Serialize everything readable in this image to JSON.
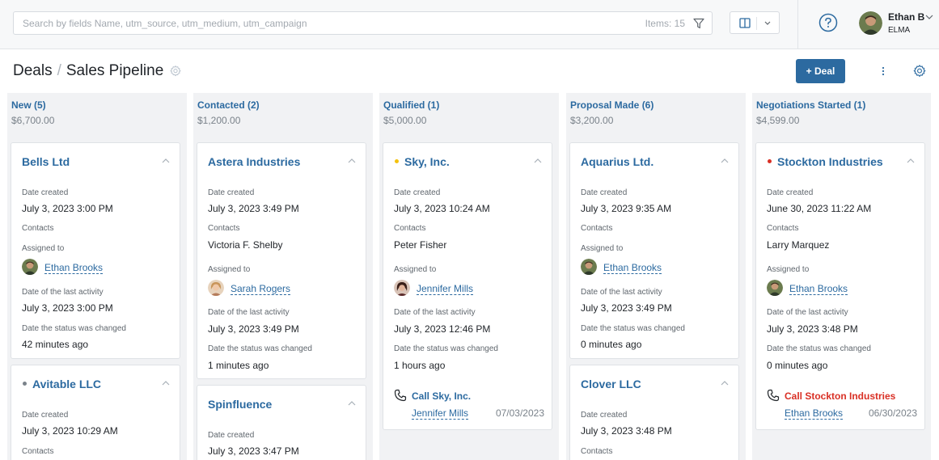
{
  "search": {
    "placeholder": "Search by fields Name, utm_source, utm_medium, utm_campaign",
    "items_count": "Items: 15"
  },
  "user": {
    "name": "Ethan B",
    "company": "ELMA"
  },
  "header": {
    "section": "Deals",
    "separator": "/",
    "page": "Sales Pipeline",
    "add_deal_label": "+ Deal"
  },
  "icons": {
    "filter": "filter-icon",
    "view": "columns-view-icon",
    "help": "help-circle-icon",
    "gear": "gear-icon",
    "more": "more-vertical-icon",
    "chevron": "chevron-up-icon",
    "phone": "phone-icon"
  },
  "colors": {
    "accent": "#2c6aa0",
    "overdue": "#d93025",
    "dot_yellow": "#f4c20d",
    "dot_red": "#d93025",
    "dot_gray": "#7a828a"
  },
  "labels": {
    "date_created": "Date created",
    "contacts": "Contacts",
    "assigned_to": "Assigned to",
    "last_activity": "Date of the last activity",
    "status_changed": "Date the status was changed"
  },
  "columns": [
    {
      "title": "New (5)",
      "sum": "$6,700.00",
      "cards": [
        {
          "name": "Bells Ltd",
          "created": "July 3, 2023 3:00 PM",
          "contact": "",
          "assignee": "Ethan Brooks",
          "last_activity": "July 3, 2023 3:00 PM",
          "status_changed": "42 minutes ago"
        },
        {
          "name": "Avitable LLC",
          "created": "July 3, 2023 10:29 AM"
        }
      ]
    },
    {
      "title": "Contacted (2)",
      "sum": "$1,200.00",
      "cards": [
        {
          "name": "Astera Industries",
          "created": "July 3, 2023 3:49 PM",
          "contact": "Victoria F. Shelby",
          "assignee": "Sarah Rogers",
          "last_activity": "July 3, 2023 3:49 PM",
          "status_changed": "1 minutes ago"
        },
        {
          "name": "Spinfluence",
          "created": "July 3, 2023 3:47 PM"
        }
      ]
    },
    {
      "title": "Qualified (1)",
      "sum": "$5,000.00",
      "cards": [
        {
          "name": "Sky, Inc.",
          "created": "July 3, 2023 10:24 AM",
          "contact": "Peter Fisher",
          "assignee": "Jennifer Mills",
          "last_activity": "July 3, 2023 12:46 PM",
          "status_changed": "1 hours ago",
          "task": {
            "title": "Call Sky, Inc.",
            "assignee": "Jennifer Mills",
            "date": "07/03/2023"
          }
        }
      ]
    },
    {
      "title": "Proposal Made (6)",
      "sum": "$3,200.00",
      "cards": [
        {
          "name": "Aquarius Ltd.",
          "created": "July 3, 2023 9:35 AM",
          "contact": "",
          "assignee": "Ethan Brooks",
          "last_activity": "July 3, 2023 3:49 PM",
          "status_changed": "0 minutes ago"
        },
        {
          "name": "Clover LLC",
          "created": "July 3, 2023 3:48 PM"
        }
      ]
    },
    {
      "title": "Negotiations Started (1)",
      "sum": "$4,599.00",
      "cards": [
        {
          "name": "Stockton Industries",
          "created": "June 30, 2023 11:22 AM",
          "contact": "Larry Marquez",
          "assignee": "Ethan Brooks",
          "last_activity": "July 3, 2023 3:48 PM",
          "status_changed": "0 minutes ago",
          "task": {
            "title": "Call Stockton Industries",
            "assignee": "Ethan Brooks",
            "date": "06/30/2023"
          }
        }
      ]
    }
  ]
}
